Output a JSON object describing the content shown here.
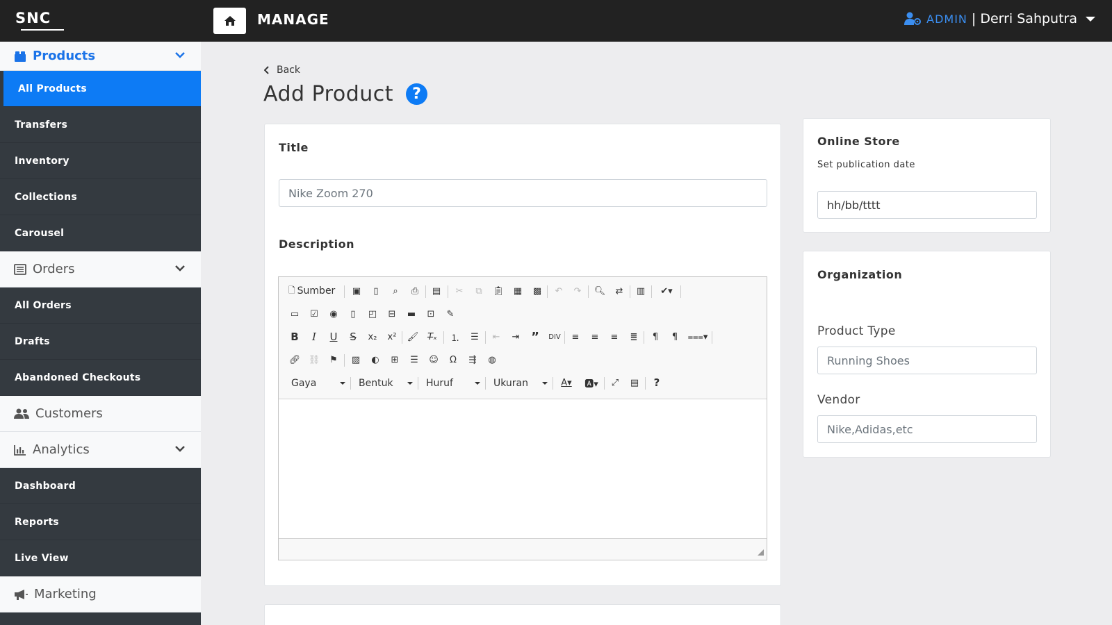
{
  "header": {
    "logo": "SNC",
    "title": "MANAGE",
    "role": "ADMIN",
    "separator": "|",
    "user_name": "Derri Sahputra"
  },
  "sidebar": {
    "groups": [
      {
        "label": "Products",
        "icon": "tag-icon",
        "items": [
          "All Products",
          "Transfers",
          "Inventory",
          "Collections",
          "Carousel"
        ]
      },
      {
        "label": "Orders",
        "icon": "list-icon",
        "items": [
          "All Orders",
          "Drafts",
          "Abandoned Checkouts"
        ]
      },
      {
        "label": "Customers",
        "icon": "users-icon",
        "items": []
      },
      {
        "label": "Analytics",
        "icon": "bar-chart-icon",
        "items": [
          "Dashboard",
          "Reports",
          "Live View"
        ]
      },
      {
        "label": "Marketing",
        "icon": "megaphone-icon",
        "items": []
      }
    ],
    "active_item": "All Products"
  },
  "page": {
    "back_label": "Back",
    "title": "Add Product",
    "help_symbol": "?"
  },
  "product_card": {
    "title_label": "Title",
    "title_placeholder": "Nike Zoom 270",
    "description_label": "Description"
  },
  "editor": {
    "source_label": "Sumber",
    "style_combo": "Gaya",
    "format_combo": "Bentuk",
    "font_combo": "Huruf",
    "size_combo": "Ukuran",
    "help_symbol": "?"
  },
  "online_store": {
    "title": "Online Store",
    "subtitle": "Set publication date",
    "date_placeholder": "hh/bb/tttt"
  },
  "organization": {
    "title": "Organization",
    "product_type_label": "Product Type",
    "product_type_placeholder": "Running Shoes",
    "vendor_label": "Vendor",
    "vendor_placeholder": "Nike,Adidas,etc"
  },
  "colors": {
    "accent": "#0d7bf5",
    "topbar": "#222222",
    "sidebar_dark": "#343a40"
  }
}
